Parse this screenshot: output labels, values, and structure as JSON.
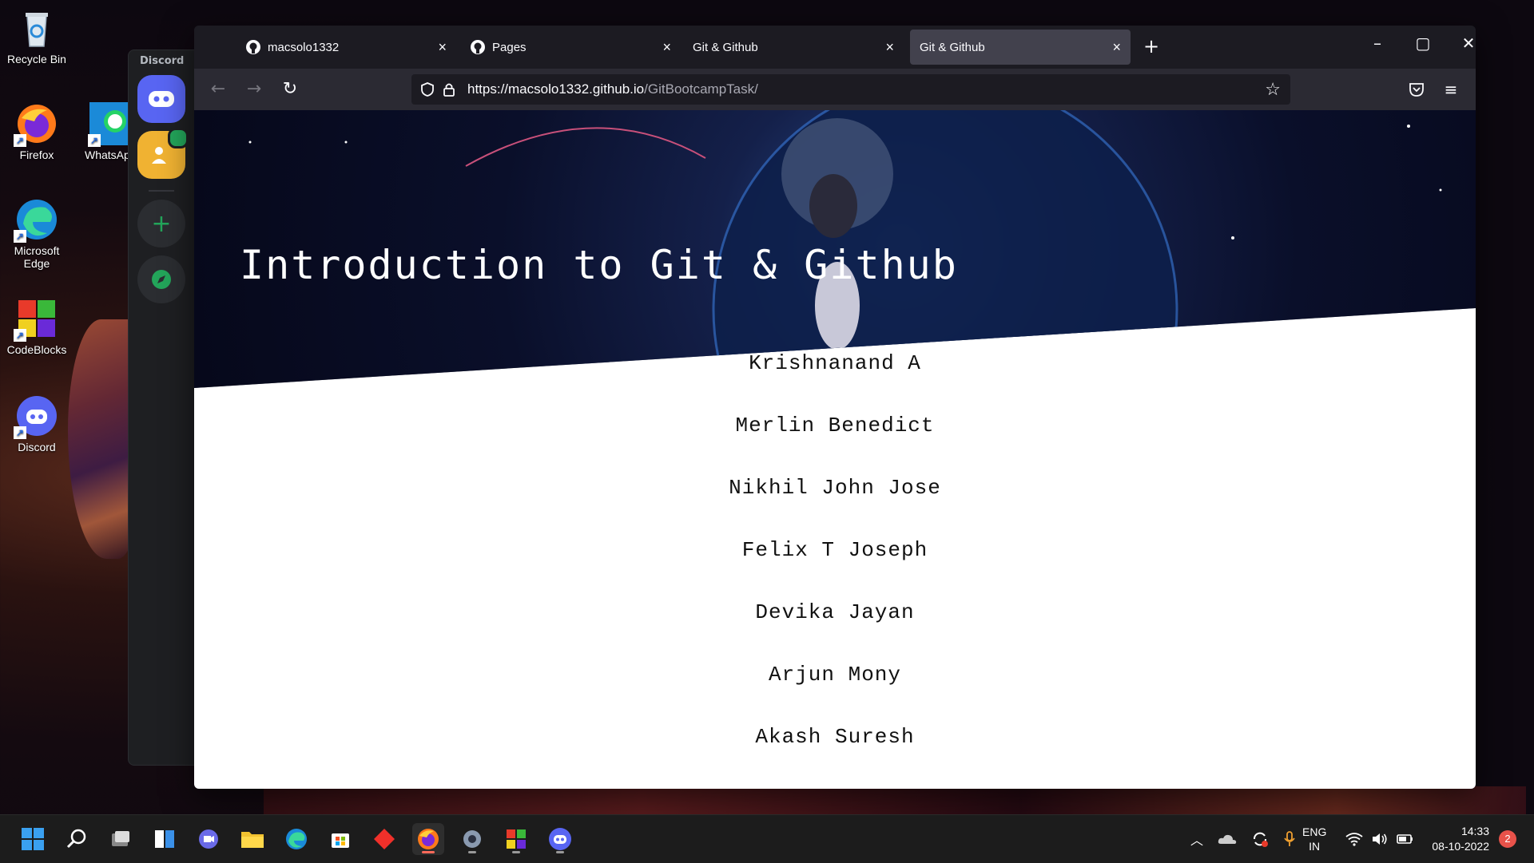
{
  "desktop": {
    "icons": [
      {
        "label": "Recycle Bin"
      },
      {
        "label": "Firefox"
      },
      {
        "label": "WhatsAp"
      },
      {
        "label": "Microsoft Edge"
      },
      {
        "label": "CodeBlocks"
      },
      {
        "label": "Discord"
      }
    ]
  },
  "discord": {
    "title": "Discord"
  },
  "browser": {
    "tabs": [
      {
        "title": "macsolo1332"
      },
      {
        "title": "Pages"
      },
      {
        "title": "Git & Github"
      },
      {
        "title": "Git & Github"
      }
    ],
    "new_tab": "+",
    "url_host": "https://macsolo1332.github.io",
    "url_path": "/GitBootcampTask/"
  },
  "page": {
    "heading": "Introduction to Git & Github",
    "names": [
      "Krishnanand A",
      "Merlin Benedict",
      "Nikhil John Jose",
      "Felix T Joseph",
      "Devika Jayan",
      "Arjun Mony",
      "Akash Suresh"
    ]
  },
  "taskbar": {
    "lang_line1": "ENG",
    "lang_line2": "IN",
    "time": "14:33",
    "date": "08-10-2022",
    "notification_count": "2"
  },
  "colors": {
    "accent_discord": "#5865f2",
    "firefox_tab_active": "#42414d"
  }
}
